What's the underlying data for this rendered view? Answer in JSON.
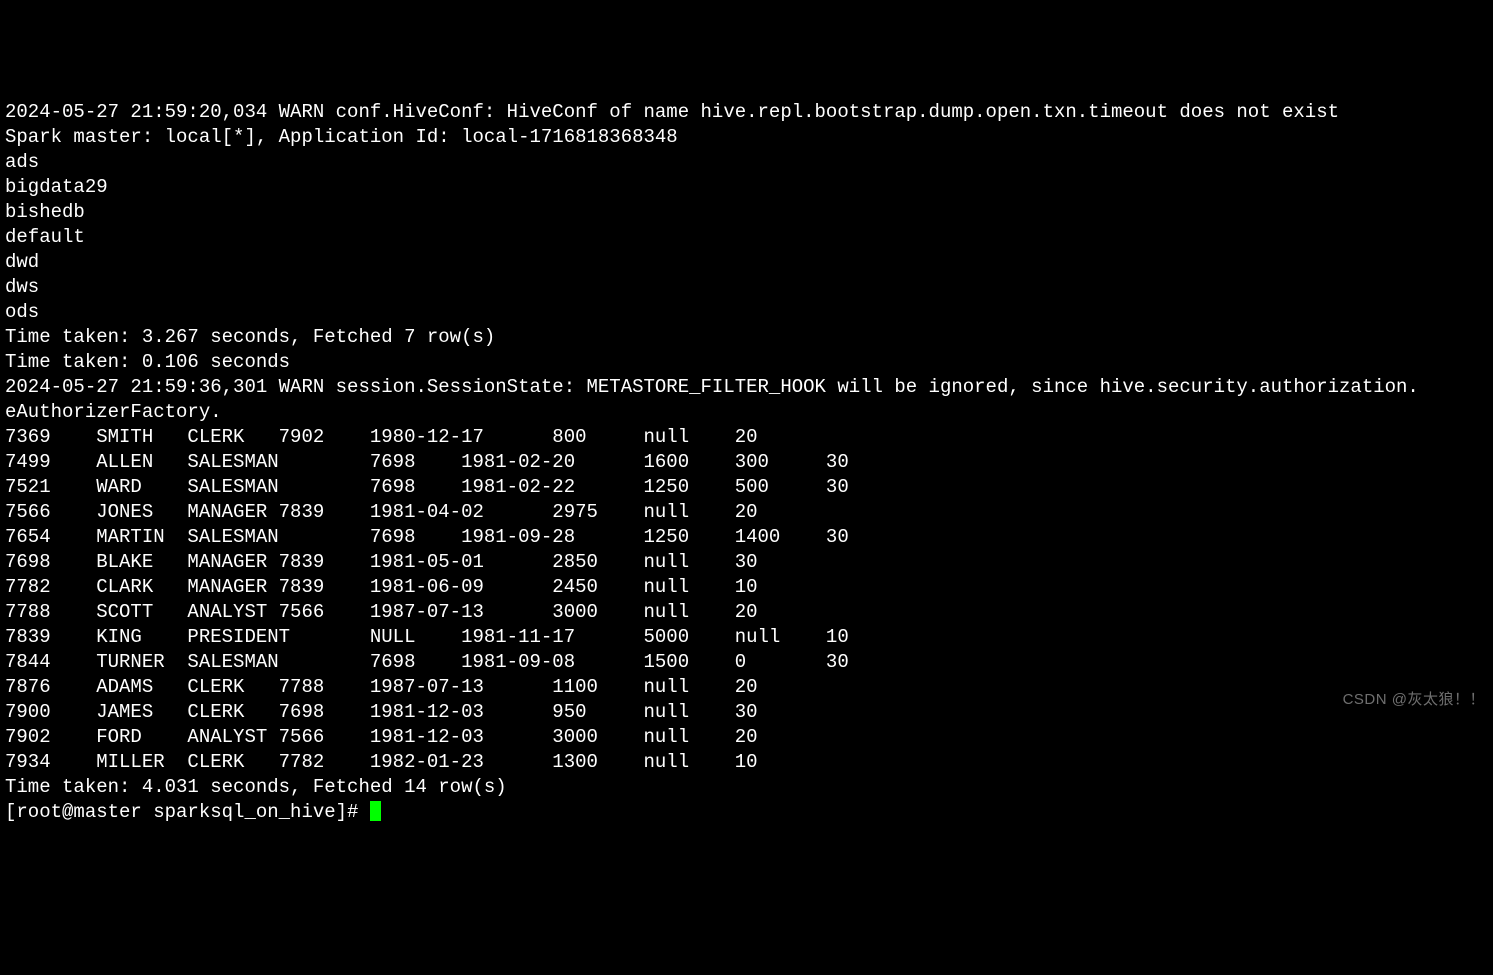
{
  "header_lines": [
    "2024-05-27 21:59:20,034 WARN conf.HiveConf: HiveConf of name hive.repl.bootstrap.dump.open.txn.timeout does not exist",
    "Spark master: local[*], Application Id: local-1716818368348"
  ],
  "db_list": [
    "ads",
    "bigdata29",
    "bishedb",
    "default",
    "dwd",
    "dws",
    "ods"
  ],
  "time_taken_dbs": "Time taken: 3.267 seconds, Fetched 7 row(s)",
  "time_taken_switch": "Time taken: 0.106 seconds",
  "warn_line_1": "2024-05-27 21:59:36,301 WARN session.SessionState: METASTORE_FILTER_HOOK will be ignored, since hive.security.authorization.",
  "warn_line_2": "eAuthorizerFactory.",
  "emp_rows": [
    {
      "empno": "7369",
      "ename": "SMITH",
      "job": "CLERK",
      "mgr": "7902",
      "hiredate": "1980-12-17",
      "sal": "800",
      "comm": "null",
      "deptno": "20"
    },
    {
      "empno": "7499",
      "ename": "ALLEN",
      "job": "SALESMAN",
      "mgr": "7698",
      "hiredate": "1981-02-20",
      "sal": "1600",
      "comm": "300",
      "deptno": "30"
    },
    {
      "empno": "7521",
      "ename": "WARD",
      "job": "SALESMAN",
      "mgr": "7698",
      "hiredate": "1981-02-22",
      "sal": "1250",
      "comm": "500",
      "deptno": "30"
    },
    {
      "empno": "7566",
      "ename": "JONES",
      "job": "MANAGER",
      "mgr": "7839",
      "hiredate": "1981-04-02",
      "sal": "2975",
      "comm": "null",
      "deptno": "20"
    },
    {
      "empno": "7654",
      "ename": "MARTIN",
      "job": "SALESMAN",
      "mgr": "7698",
      "hiredate": "1981-09-28",
      "sal": "1250",
      "comm": "1400",
      "deptno": "30"
    },
    {
      "empno": "7698",
      "ename": "BLAKE",
      "job": "MANAGER",
      "mgr": "7839",
      "hiredate": "1981-05-01",
      "sal": "2850",
      "comm": "null",
      "deptno": "30"
    },
    {
      "empno": "7782",
      "ename": "CLARK",
      "job": "MANAGER",
      "mgr": "7839",
      "hiredate": "1981-06-09",
      "sal": "2450",
      "comm": "null",
      "deptno": "10"
    },
    {
      "empno": "7788",
      "ename": "SCOTT",
      "job": "ANALYST",
      "mgr": "7566",
      "hiredate": "1987-07-13",
      "sal": "3000",
      "comm": "null",
      "deptno": "20"
    },
    {
      "empno": "7839",
      "ename": "KING",
      "job": "PRESIDENT",
      "mgr": "NULL",
      "hiredate": "1981-11-17",
      "sal": "5000",
      "comm": "null",
      "deptno": "10"
    },
    {
      "empno": "7844",
      "ename": "TURNER",
      "job": "SALESMAN",
      "mgr": "7698",
      "hiredate": "1981-09-08",
      "sal": "1500",
      "comm": "0",
      "deptno": "30"
    },
    {
      "empno": "7876",
      "ename": "ADAMS",
      "job": "CLERK",
      "mgr": "7788",
      "hiredate": "1987-07-13",
      "sal": "1100",
      "comm": "null",
      "deptno": "20"
    },
    {
      "empno": "7900",
      "ename": "JAMES",
      "job": "CLERK",
      "mgr": "7698",
      "hiredate": "1981-12-03",
      "sal": "950",
      "comm": "null",
      "deptno": "30"
    },
    {
      "empno": "7902",
      "ename": "FORD",
      "job": "ANALYST",
      "mgr": "7566",
      "hiredate": "1981-12-03",
      "sal": "3000",
      "comm": "null",
      "deptno": "20"
    },
    {
      "empno": "7934",
      "ename": "MILLER",
      "job": "CLERK",
      "mgr": "7782",
      "hiredate": "1982-01-23",
      "sal": "1300",
      "comm": "null",
      "deptno": "10"
    }
  ],
  "time_taken_emp": "Time taken: 4.031 seconds, Fetched 14 row(s)",
  "prompt": "[root@master sparksql_on_hive]# ",
  "watermark": "CSDN @灰太狼！！"
}
